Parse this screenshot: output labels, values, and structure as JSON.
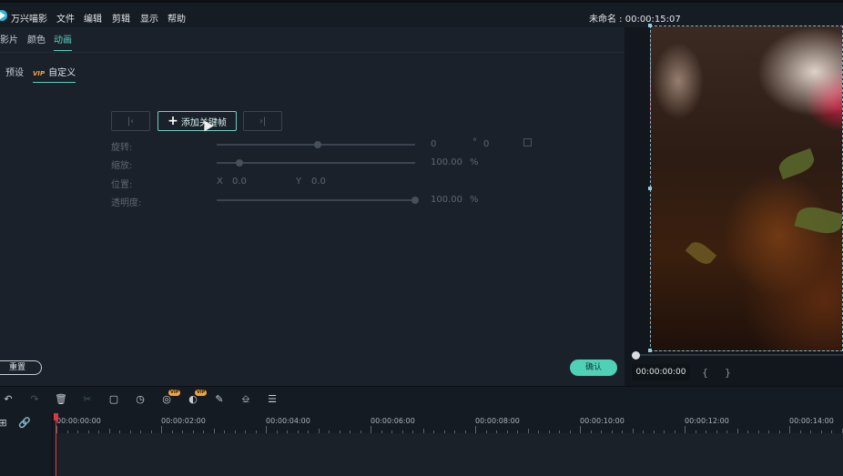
{
  "menubar": {
    "app_name": "万兴喵影",
    "items": [
      "文件",
      "编辑",
      "剪辑",
      "显示",
      "帮助"
    ],
    "project_title": "未命名 : 00:00:15:07"
  },
  "panel": {
    "tabs": [
      "影片",
      "颜色",
      "动画"
    ],
    "active_tab": "动画",
    "subtabs": [
      "预设",
      "自定义"
    ],
    "vip_label": "VIP",
    "keyframe": {
      "add_label": "添加关键帧"
    },
    "rows": {
      "rotate": {
        "label": "旋转:",
        "value1": "0",
        "unit": "°",
        "value2": "0",
        "level": 0.5
      },
      "scale": {
        "label": "缩放:",
        "value": "100.00",
        "unit": "%",
        "level": 0.1
      },
      "position": {
        "label": "位置:",
        "x_label": "X",
        "x_value": "0.0",
        "y_label": "Y",
        "y_value": "0.0"
      },
      "opacity": {
        "label": "透明度:",
        "value": "100.00",
        "unit": "%",
        "level": 1.0
      }
    },
    "reset_label": "重置",
    "ok_label": "确认"
  },
  "preview": {
    "timecode": "00:00:00:00",
    "mark_in": "{",
    "mark_out": "}"
  },
  "toolbar": {
    "icons": [
      "undo-icon",
      "redo-icon",
      "delete-icon",
      "cut-icon",
      "crop-icon",
      "speed-icon",
      "stabilize-icon",
      "color-match-icon",
      "pen-icon",
      "marker-icon",
      "adjust-icon"
    ],
    "vip_badge": "VIP"
  },
  "timeline": {
    "ticks": [
      "00:00:00:00",
      "00:00:02:00",
      "00:00:04:00",
      "00:00:06:00",
      "00:00:08:00",
      "00:00:10:00",
      "00:00:12:00",
      "00:00:14:00"
    ]
  },
  "colors": {
    "accent": "#58d1c0",
    "ok_button": "#4fd1b8",
    "vip": "#f0a43c",
    "playhead": "#e0363b"
  }
}
